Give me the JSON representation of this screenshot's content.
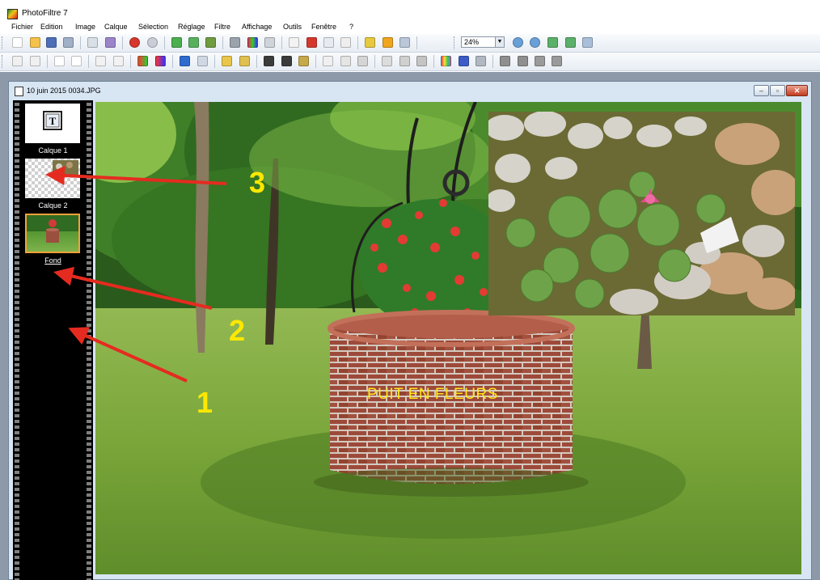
{
  "app": {
    "title": "PhotoFiltre 7"
  },
  "menu": [
    "Fichier",
    "Edition",
    "Image",
    "Calque",
    "Sélection",
    "Réglage",
    "Filtre",
    "Affichage",
    "Outils",
    "Fenêtre",
    "?"
  ],
  "toolbar": {
    "zoom_value": "24%"
  },
  "document": {
    "title": "10 juin 2015 0034.JPG"
  },
  "layers": [
    {
      "label": "Calque 1",
      "kind": "text-layer"
    },
    {
      "label": "Calque 2",
      "kind": "transparent-image"
    },
    {
      "label": "Fond",
      "kind": "background",
      "selected": true
    }
  ],
  "canvas": {
    "overlay_text": "PUIT EN FLEURS"
  },
  "annotations": [
    "1",
    "2",
    "3"
  ],
  "colors": {
    "annotation_arrow": "#e52b20",
    "annotation_number": "#ffe800",
    "overlay_text": "#ffe619"
  }
}
